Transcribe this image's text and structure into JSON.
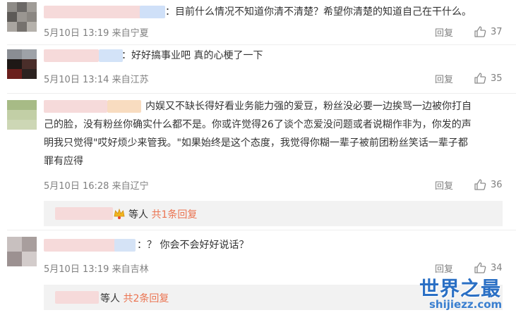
{
  "comments": [
    {
      "text": "：目前什么情况不知道你清不清楚？希望你清楚的知道自己在干什么。",
      "time": "5月10日 13:19",
      "location": "来自宁夏",
      "reply_label": "回复",
      "likes": "37"
    },
    {
      "text": "：好好搞事业吧 真的心梗了一下",
      "time": "5月10日 13:14",
      "location": "来自江苏",
      "reply_label": "回复",
      "likes": "35"
    },
    {
      "text_lines": [
        "内娱又不缺长得好看业务能力强的爱豆，粉丝没必要一边挨骂一边被你打自",
        "己的脸，没有粉丝你确实什么都不是。你或许觉得26了谈个恋爱没问题或者说糊作非为，你发的声",
        "明我只觉得\"哎好烦少来管我。\"如果始终是这个态度，我觉得你糊一辈子被前团粉丝笑话一辈子都",
        "罪有应得"
      ],
      "time": "5月10日 16:28",
      "location": "来自辽宁",
      "reply_label": "回复",
      "likes": "36",
      "subreply": {
        "etc": "等人",
        "more": "共1条回复"
      }
    },
    {
      "text": "：？ 你会不会好好说话？",
      "time": "5月10日 13:19",
      "location": "来自吉林",
      "reply_label": "回复",
      "likes": "34",
      "subreply": {
        "etc": "等人",
        "more": "共2条回复"
      }
    }
  ],
  "watermark": {
    "title": "世界之最",
    "url": "shijiezz.com"
  },
  "colors": {
    "link_orange": "#eb7350",
    "meta_gray": "#808080",
    "subbox_bg": "#f2f2f2",
    "watermark_blue": "#2a6fc4"
  }
}
